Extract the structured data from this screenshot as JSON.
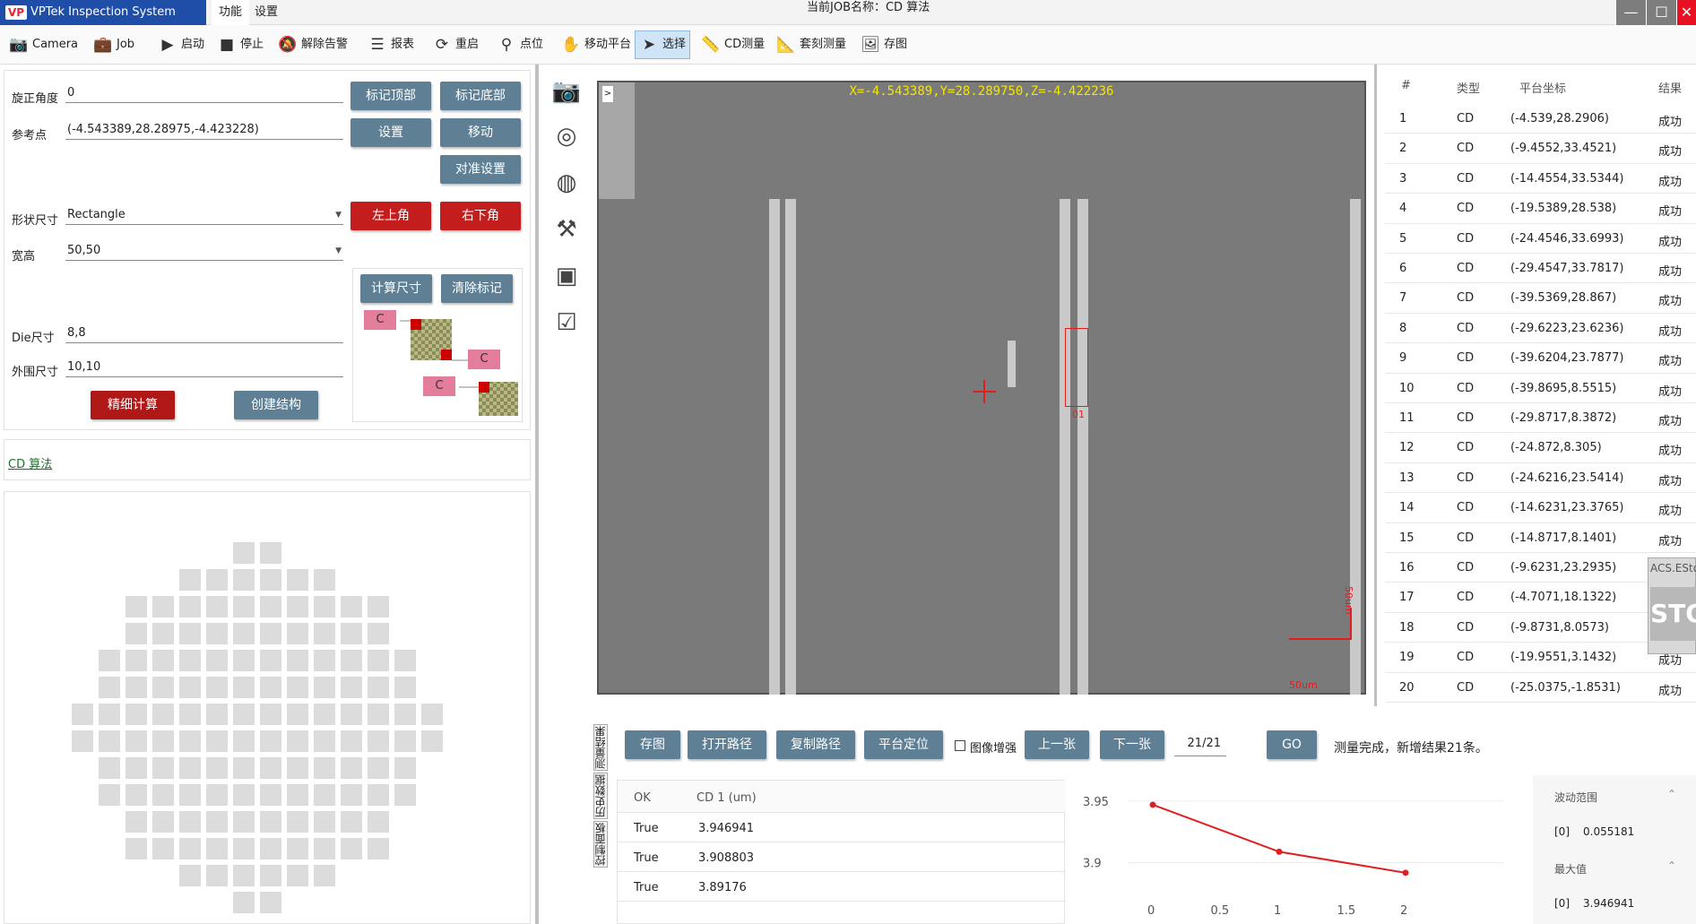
{
  "app": {
    "logo_mark": "VP",
    "title": "VPTek Inspection System 1.0.0.0",
    "menus": [
      "功能",
      "设置"
    ],
    "job_label": "当前JOB名称：CD 算法"
  },
  "window": {
    "minimize": "—",
    "maximize": "☐",
    "close": "✕"
  },
  "toolbar": [
    {
      "icon": "camera-icon",
      "glyph": "📷",
      "label": "Camera"
    },
    {
      "icon": "briefcase-icon",
      "glyph": "💼",
      "label": "Job"
    },
    {
      "icon": "play-icon",
      "glyph": "▶",
      "label": "启动"
    },
    {
      "icon": "stop-icon",
      "glyph": "■",
      "label": "停止"
    },
    {
      "icon": "alarm-off-icon",
      "glyph": "🔕",
      "label": "解除告警"
    },
    {
      "icon": "report-icon",
      "glyph": "☰",
      "label": "报表"
    },
    {
      "icon": "restart-icon",
      "glyph": "⟳",
      "label": "重启"
    },
    {
      "icon": "location-icon",
      "glyph": "⚲",
      "label": "点位"
    },
    {
      "icon": "hand-move-icon",
      "glyph": "✋",
      "label": "移动平台"
    },
    {
      "icon": "cursor-icon",
      "glyph": "➤",
      "label": "选择"
    },
    {
      "icon": "ruler-icon",
      "glyph": "📏",
      "label": "CD测量"
    },
    {
      "icon": "ruler-overlay-icon",
      "glyph": "📐",
      "label": "套刻测量"
    },
    {
      "icon": "image-save-icon",
      "glyph": "🖼",
      "label": "存图"
    }
  ],
  "setup": {
    "rotation_label": "旋正角度",
    "rotation_value": "0",
    "ref_label": "参考点",
    "ref_value": "(-4.543389,28.28975,-4.423228)",
    "shape_label": "形状尺寸",
    "shape_value": "Rectangle",
    "size_label": "宽高",
    "size_value": "50,50",
    "die_label": "Die尺寸",
    "die_value": "8,8",
    "outer_label": "外围尺寸",
    "outer_value": "10,10",
    "btn_mark_top": "标记顶部",
    "btn_mark_bottom": "标记底部",
    "btn_set": "设置",
    "btn_move": "移动",
    "btn_align": "对准设置",
    "btn_top_left": "左上角",
    "btn_bottom_right": "右下角",
    "btn_calc_size": "计算尺寸",
    "btn_clear_mark": "清除标记",
    "btn_fine_calc": "精细计算",
    "btn_create": "创建结构",
    "c_label": "C"
  },
  "algo_link": "CD 算法",
  "viewer": {
    "expand": ">",
    "coord": "X=-4.543389,Y=28.289750,Z=-4.422236",
    "roi_label": "01",
    "scale_h": "50um",
    "scale_v": "50um"
  },
  "results": {
    "headers": [
      "#",
      "类型",
      "平台坐标",
      "结果"
    ],
    "rows": [
      [
        "1",
        "CD",
        "(-4.539,28.2906)",
        "成功"
      ],
      [
        "2",
        "CD",
        "(-9.4552,33.4521)",
        "成功"
      ],
      [
        "3",
        "CD",
        "(-14.4554,33.5344)",
        "成功"
      ],
      [
        "4",
        "CD",
        "(-19.5389,28.538)",
        "成功"
      ],
      [
        "5",
        "CD",
        "(-24.4546,33.6993)",
        "成功"
      ],
      [
        "6",
        "CD",
        "(-29.4547,33.7817)",
        "成功"
      ],
      [
        "7",
        "CD",
        "(-39.5369,28.867)",
        "成功"
      ],
      [
        "8",
        "CD",
        "(-29.6223,23.6236)",
        "成功"
      ],
      [
        "9",
        "CD",
        "(-39.6204,23.7877)",
        "成功"
      ],
      [
        "10",
        "CD",
        "(-39.8695,8.5515)",
        "成功"
      ],
      [
        "11",
        "CD",
        "(-29.8717,8.3872)",
        "成功"
      ],
      [
        "12",
        "CD",
        "(-24.872,8.305)",
        "成功"
      ],
      [
        "13",
        "CD",
        "(-24.6216,23.5414)",
        "成功"
      ],
      [
        "14",
        "CD",
        "(-14.6231,23.3765)",
        "成功"
      ],
      [
        "15",
        "CD",
        "(-14.8717,8.1401)",
        "成功"
      ],
      [
        "16",
        "CD",
        "(-9.6231,23.2935)",
        "成功"
      ],
      [
        "17",
        "CD",
        "(-4.7071,18.1322)",
        "成功"
      ],
      [
        "18",
        "CD",
        "(-9.8731,8.0573)",
        "成功"
      ],
      [
        "19",
        "CD",
        "(-19.9551,3.1432)",
        "成功"
      ],
      [
        "20",
        "CD",
        "(-25.0375,-1.8531)",
        "成功"
      ]
    ]
  },
  "estop": {
    "title": "ACS.ESto",
    "sign": "STO"
  },
  "bottom": {
    "tabs": [
      "测量结果",
      "历史数据",
      "控制面板"
    ],
    "btn_save": "存图",
    "btn_open": "打开路径",
    "btn_copy": "复制路径",
    "btn_locate": "平台定位",
    "enhance_label": "图像增强",
    "btn_prev": "上一张",
    "btn_next": "下一张",
    "page_value": "21/21",
    "btn_go": "GO",
    "status": "测量完成，新增结果21条。",
    "grid_headers": [
      "OK",
      "CD 1 (um)"
    ],
    "grid_rows": [
      [
        "True",
        "3.946941"
      ],
      [
        "True",
        "3.908803"
      ],
      [
        "True",
        "3.89176"
      ]
    ],
    "stats": {
      "range_label": "波动范围",
      "range_idx": "[0]",
      "range_value": "0.055181",
      "max_label": "最大值",
      "max_idx": "[0]",
      "max_value": "3.946941"
    }
  },
  "chart_data": {
    "type": "line",
    "x": [
      0,
      1,
      2
    ],
    "series": [
      {
        "values": [
          3.946941,
          3.908803,
          3.89176
        ],
        "color": "#e02020"
      }
    ],
    "xticks": [
      "0",
      "0.5",
      "1",
      "1.5",
      "2"
    ],
    "yticks": [
      "3.95",
      "3.9"
    ],
    "xlim": [
      0,
      2
    ],
    "ylim": [
      3.88,
      3.96
    ]
  },
  "wafer_rows": [
    {
      "count": 2
    },
    {
      "count": 6
    },
    {
      "count": 10
    },
    {
      "count": 10
    },
    {
      "count": 12
    },
    {
      "count": 12
    },
    {
      "count": 14
    },
    {
      "count": 14
    },
    {
      "count": 12
    },
    {
      "count": 12
    },
    {
      "count": 10
    },
    {
      "count": 10
    },
    {
      "count": 6
    },
    {
      "count": 2
    }
  ]
}
